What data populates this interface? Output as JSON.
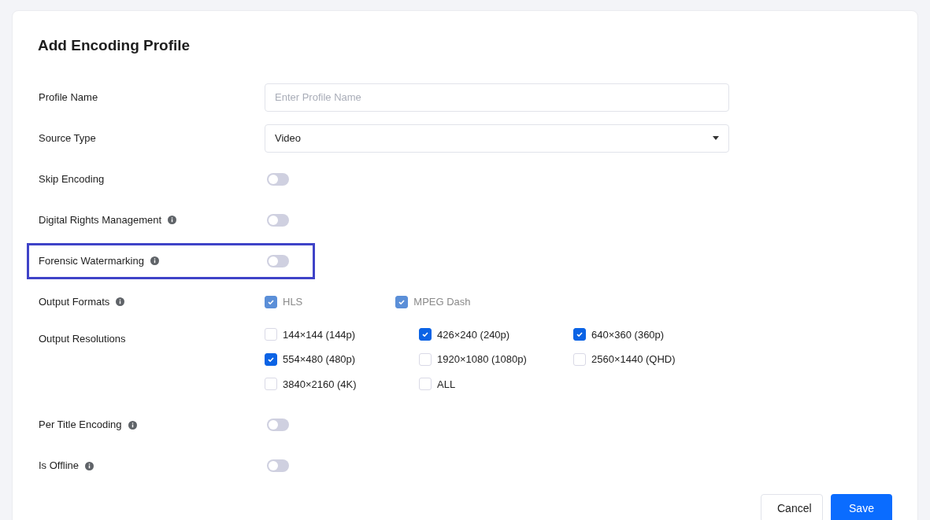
{
  "title": "Add Encoding Profile",
  "fields": [
    {
      "kind": "text",
      "label": "Profile Name",
      "info": false,
      "placeholder": "Enter Profile Name"
    },
    {
      "kind": "select",
      "label": "Source Type",
      "info": false,
      "value": "Video"
    },
    {
      "kind": "toggle",
      "label": "Skip Encoding",
      "info": false,
      "on": false,
      "highlighted": false
    },
    {
      "kind": "toggle",
      "label": "Digital Rights Management",
      "info": true,
      "on": false,
      "highlighted": false
    },
    {
      "kind": "toggle",
      "label": "Forensic Watermarking",
      "info": true,
      "on": false,
      "highlighted": true
    },
    {
      "kind": "checkboxes",
      "label": "Output Formats",
      "info": true,
      "disabled": true,
      "options": [
        {
          "label": "HLS",
          "checked": true
        },
        {
          "label": "MPEG Dash",
          "checked": true
        }
      ]
    },
    {
      "kind": "checkboxes",
      "label": "Output Resolutions",
      "info": false,
      "disabled": false,
      "options": [
        {
          "label": "144×144 (144p)",
          "checked": false
        },
        {
          "label": "426×240 (240p)",
          "checked": true
        },
        {
          "label": "640×360 (360p)",
          "checked": true
        },
        {
          "label": "554×480 (480p)",
          "checked": true
        },
        {
          "label": "1920×1080 (1080p)",
          "checked": false
        },
        {
          "label": "2560×1440 (QHD)",
          "checked": false
        },
        {
          "label": "3840×2160 (4K)",
          "checked": false
        },
        {
          "label": "ALL",
          "checked": false
        }
      ]
    },
    {
      "kind": "toggle",
      "label": "Per Title Encoding",
      "info": true,
      "on": false,
      "highlighted": false
    },
    {
      "kind": "toggle",
      "label": "Is Offline",
      "info": true,
      "on": false,
      "highlighted": false
    }
  ],
  "buttons": [
    {
      "kind": "secondary",
      "label": "Cancel"
    },
    {
      "kind": "primary",
      "label": "Save"
    }
  ]
}
